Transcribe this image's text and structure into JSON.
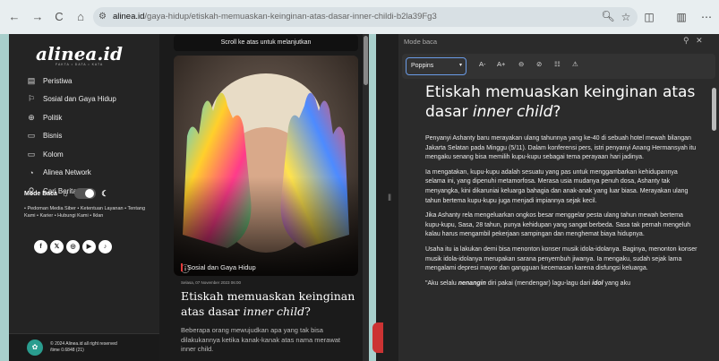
{
  "browser": {
    "nav": {
      "back": "←",
      "forward": "→",
      "reload": "C",
      "home": "⌂"
    },
    "url_host": "alinea.id",
    "url_path": "/gaya-hidup/etiskah-memuaskan-keinginan-atas-dasar-inner-childi-b2la39Fg3",
    "right_icons": [
      "search-icon",
      "star-icon",
      "extensions-icon",
      "reading-mode-icon",
      "menu-icon"
    ]
  },
  "site": {
    "logo": "alinea.id",
    "tagline": "FAKTA • DATA • KATA",
    "menu": [
      {
        "icon": "▤",
        "label": "Peristiwa"
      },
      {
        "icon": "⚐",
        "label": "Sosial dan Gaya Hidup"
      },
      {
        "icon": "⊕",
        "label": "Politik"
      },
      {
        "icon": "▭",
        "label": "Bisnis"
      },
      {
        "icon": "▭",
        "label": "Kolom"
      },
      {
        "icon": "◔",
        "label": "Alinea Network"
      },
      {
        "icon": "⚲",
        "label": "Cari Berita"
      }
    ],
    "mode_baca": "Mode Baca",
    "footer_links": "• Pedoman Media Siber • Ketentuan Layanan • Tentang Kami • Karier • Hubungi Kami • Iklan",
    "socials": [
      "f",
      "𝕏",
      "◎",
      "▶",
      "♪"
    ],
    "copyright": "© 2024 Alinea.id all right reserved",
    "time": "/time 0.6848 (21)"
  },
  "article": {
    "scroll_note": "Scroll ke atas untuk melanjutkan",
    "section": "Sosial dan Gaya Hidup",
    "date": "Selasa, 07 November 2023 06:00",
    "headline_a": "Etiskah memuaskan keinginan atas dasar ",
    "headline_b": "inner child",
    "headline_c": "?",
    "lede": "Beberapa orang mewujudkan apa yang tak bisa dilakukannya ketika kanak-kanak atas nama merawat inner child."
  },
  "reader": {
    "header": "Mode baca",
    "font": "Poppins",
    "tools": [
      "A-",
      "A+",
      "⊖",
      "⊘",
      "☷",
      "⚠"
    ],
    "title_a": "Etiskah memuaskan keinginan atas dasar ",
    "title_b": "inner child",
    "title_c": "?",
    "p1": "Penyanyi Ashanty baru merayakan ulang tahunnya yang ke-40 di sebuah hotel mewah bilangan Jakarta Selatan pada Minggu (5/11). Dalam konferensi pers, istri penyanyi Anang Hermansyah itu mengaku senang bisa memilih kupu-kupu sebagai tema perayaan hari jadinya.",
    "p2": "Ia mengatakan, kupu-kupu adalah sesuatu yang pas untuk menggambarkan kehidupannya selama ini, yang dipenuhi metamorfosa. Merasa usia mudanya penuh dosa, Ashanty tak menyangka, kini dikaruniai keluarga bahagia dan anak-anak yang luar biasa. Merayakan ulang tahun bertema kupu-kupu juga menjadi impiannya sejak kecil.",
    "p3": "Jika Ashanty rela mengeluarkan ongkos besar menggelar pesta ulang tahun mewah bertema kupu-kupu, Sasa, 28 tahun, punya kehidupan yang sangat berbeda. Sasa tak pernah mengeluh kalau harus mengambil pekerjaan sampingan dan menghemat biaya hidupnya.",
    "p4": "Usaha itu ia lakukan demi bisa menonton konser musik idola-idolanya. Baginya, menonton konser musik idola-idolanya merupakan sarana penyembuh jiwanya. Ia mengaku, sudah sejak lama mengalami depresi mayor dan gangguan kecemasan karena disfungsi keluarga.",
    "p5_a": "\"Aku selalu ",
    "p5_b": "nenangin",
    "p5_c": " diri pakai (mendengar) lagu-lagu dari ",
    "p5_d": "idol",
    "p5_e": " yang aku"
  }
}
